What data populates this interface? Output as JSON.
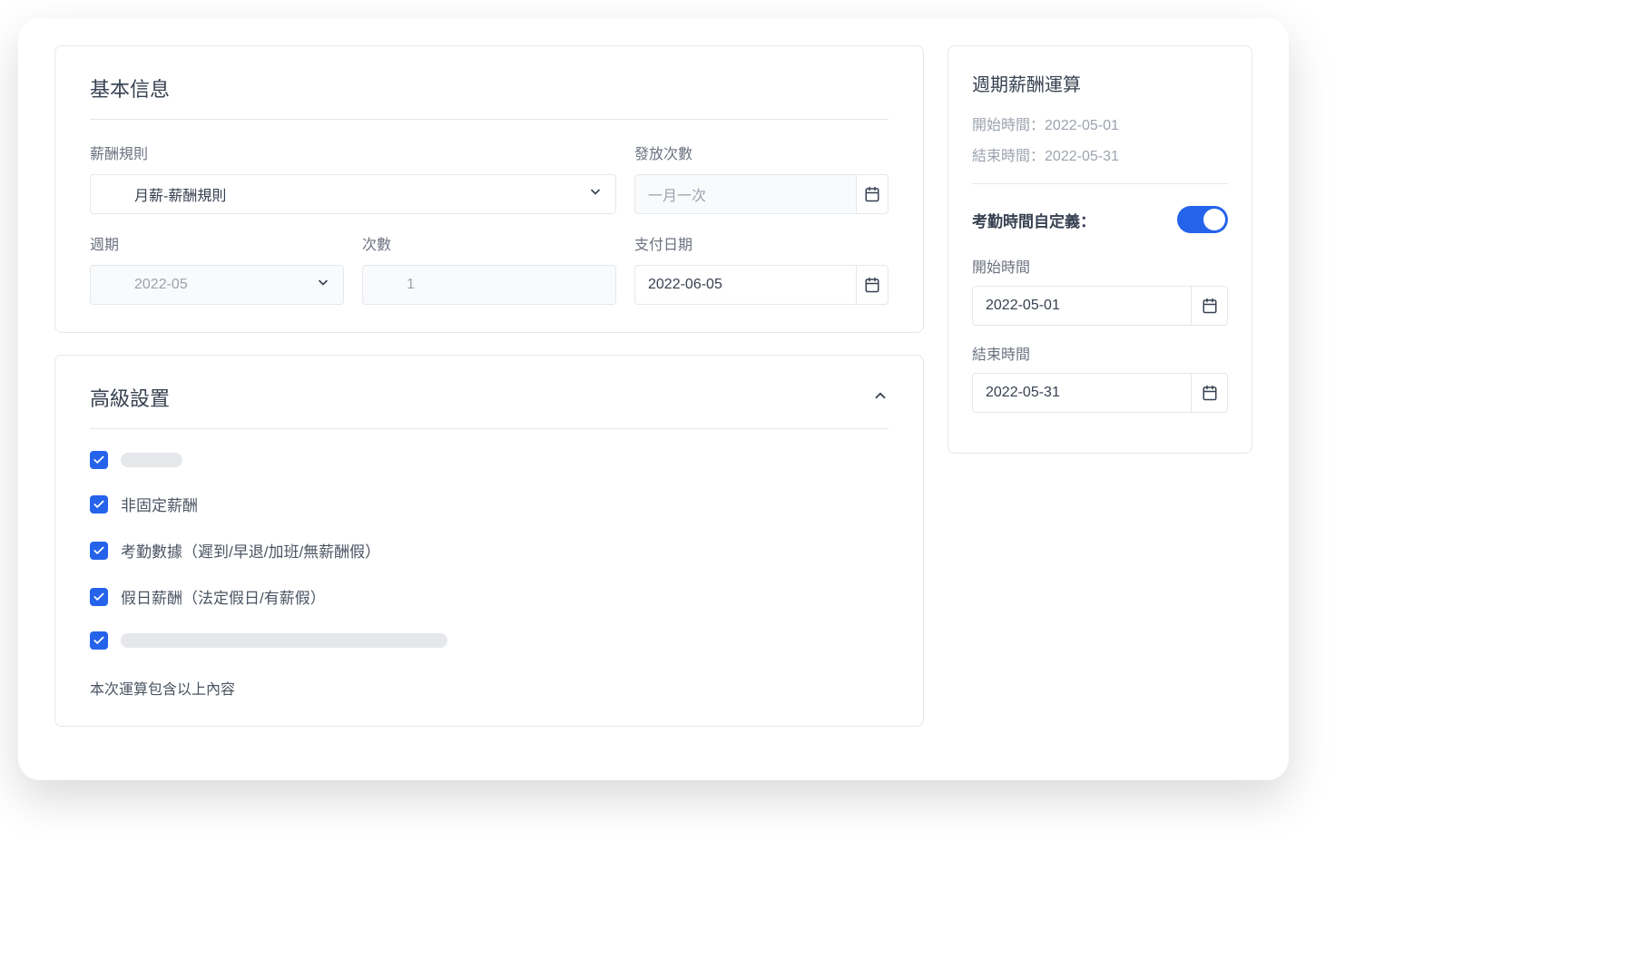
{
  "basic": {
    "title": "基本信息",
    "salary_rule": {
      "label": "薪酬規則",
      "value": "月薪-薪酬規則"
    },
    "payout_count": {
      "label": "發放次數",
      "placeholder": "一月一次"
    },
    "period": {
      "label": "週期",
      "value": "2022-05"
    },
    "times": {
      "label": "次數",
      "value": "1"
    },
    "pay_date": {
      "label": "支付日期",
      "value": "2022-06-05"
    }
  },
  "advanced": {
    "title": "高級設置",
    "options": [
      {
        "checked": true,
        "label": "",
        "skeleton": true,
        "skel_width": 68
      },
      {
        "checked": true,
        "label": "非固定薪酬",
        "skeleton": false
      },
      {
        "checked": true,
        "label": "考勤數據（遲到/早退/加班/無薪酬假）",
        "skeleton": false
      },
      {
        "checked": true,
        "label": "假日薪酬（法定假日/有薪假）",
        "skeleton": false
      },
      {
        "checked": true,
        "label": "",
        "skeleton": true,
        "skel_width": 360
      }
    ],
    "footnote": "本次運算包含以上內容"
  },
  "side": {
    "title": "週期薪酬運算",
    "start_label": "開始時間：",
    "start_value": "2022-05-01",
    "end_label": "結束時間：",
    "end_value": "2022-05-31",
    "toggle_label": "考勤時間自定義：",
    "toggle_on": true,
    "custom_start_label": "開始時間",
    "custom_start_value": "2022-05-01",
    "custom_end_label": "結束時間",
    "custom_end_value": "2022-05-31"
  }
}
